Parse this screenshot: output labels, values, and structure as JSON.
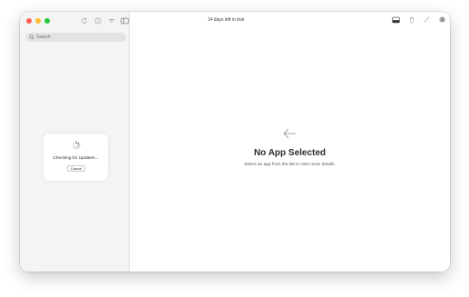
{
  "window": {
    "trial_text": "14 days left in trial",
    "accent": "#ff5f57"
  },
  "sidebar": {
    "search_placeholder": "Search",
    "update_status": "Checking for Updates...",
    "cancel_label": "Cancel"
  },
  "toolbar_icons": [
    "refresh-icon",
    "info-icon",
    "filter-icon",
    "sidebar-toggle-icon"
  ],
  "right_toolbar_icons": [
    "inspector-icon",
    "trash-icon",
    "magic-clean-icon",
    "gear-icon"
  ],
  "main": {
    "empty_title": "No App Selected",
    "empty_subtitle": "Select an app from the list to view more details."
  }
}
